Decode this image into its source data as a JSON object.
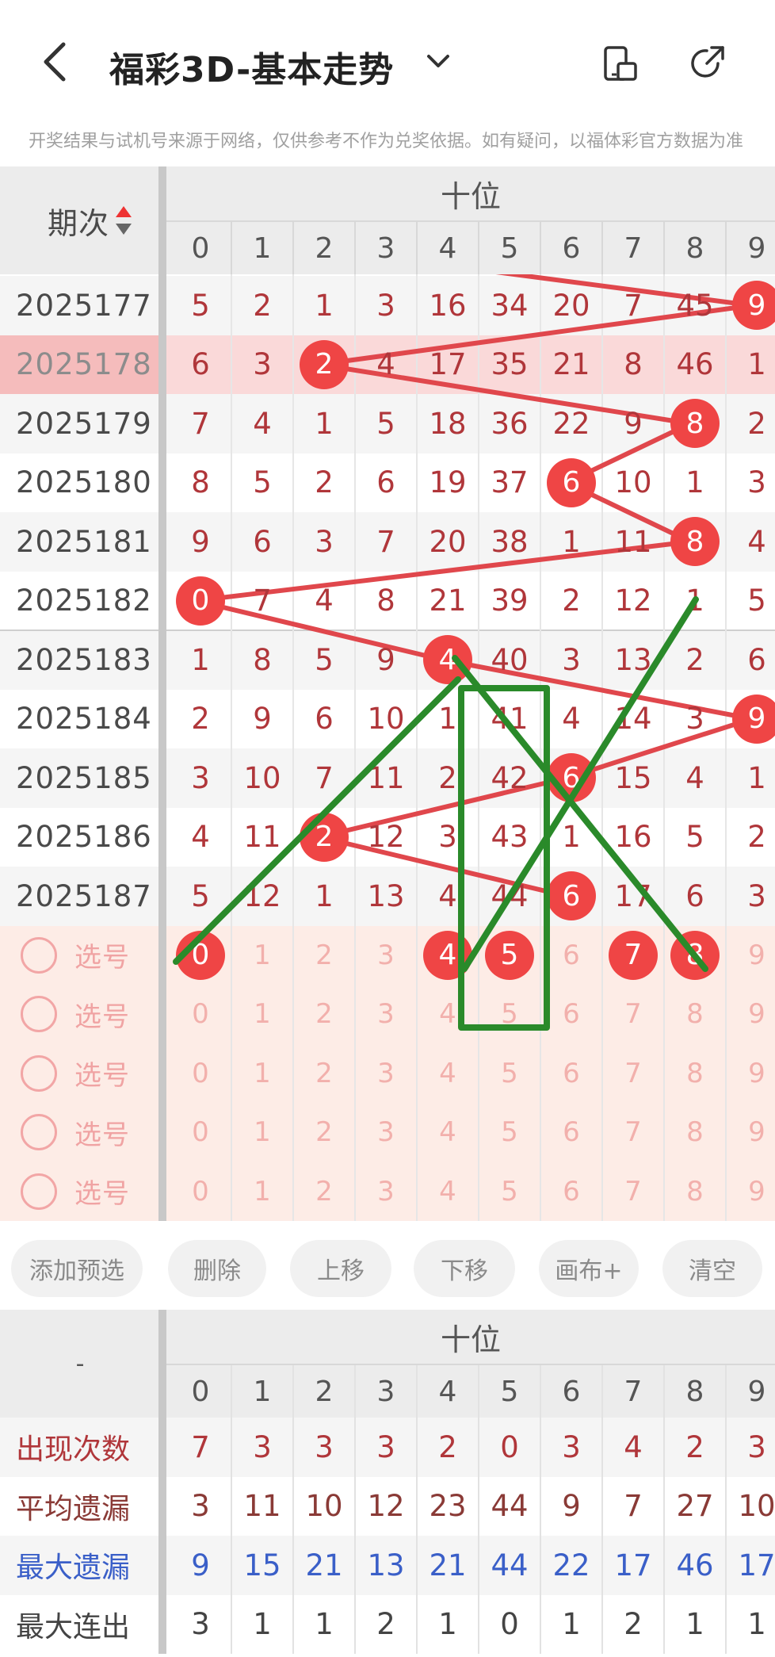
{
  "header": {
    "title": "福彩3D-基本走势",
    "back_icon": "chevron-left-icon",
    "dropdown_icon": "chevron-down-icon",
    "phone_icon": "phone-rotate-icon",
    "share_icon": "share-icon"
  },
  "notice": "开奖结果与试机号来源于网络，仅供参考不作为兑奖依据。如有疑问，以福体彩官方数据为准",
  "colors": {
    "ball_red": "#ef4545",
    "number_red": "#b0363a",
    "line_red": "#e0474c",
    "draw_green": "#2a8a2a",
    "blue": "#3a5fc8",
    "selection_bg": "#fdece6",
    "highlight_row": "#fad9d9"
  },
  "trend": {
    "issue_header": "期次",
    "sort_icon": "sort-arrows-icon",
    "group_header": "十位",
    "digits": [
      "0",
      "1",
      "2",
      "3",
      "4",
      "5",
      "6",
      "7",
      "8",
      "9"
    ],
    "rows": [
      {
        "issue": "2025177",
        "values": [
          "5",
          "2",
          "1",
          "3",
          "16",
          "34",
          "20",
          "7",
          "45",
          "9"
        ],
        "hit": 9
      },
      {
        "issue": "2025178",
        "values": [
          "6",
          "3",
          "2",
          "4",
          "17",
          "35",
          "21",
          "8",
          "46",
          "1"
        ],
        "hit": 2,
        "highlight": true
      },
      {
        "issue": "2025179",
        "values": [
          "7",
          "4",
          "1",
          "5",
          "18",
          "36",
          "22",
          "9",
          "8",
          "2"
        ],
        "hit": 8
      },
      {
        "issue": "2025180",
        "values": [
          "8",
          "5",
          "2",
          "6",
          "19",
          "37",
          "6",
          "10",
          "1",
          "3"
        ],
        "hit": 6
      },
      {
        "issue": "2025181",
        "values": [
          "9",
          "6",
          "3",
          "7",
          "20",
          "38",
          "1",
          "11",
          "8",
          "4"
        ],
        "hit": 8
      },
      {
        "issue": "2025182",
        "values": [
          "0",
          "7",
          "4",
          "8",
          "21",
          "39",
          "2",
          "12",
          "1",
          "5"
        ],
        "hit": 0
      },
      {
        "issue": "2025183",
        "values": [
          "1",
          "8",
          "5",
          "9",
          "4",
          "40",
          "3",
          "13",
          "2",
          "6"
        ],
        "hit": 4
      },
      {
        "issue": "2025184",
        "values": [
          "2",
          "9",
          "6",
          "10",
          "1",
          "41",
          "4",
          "14",
          "3",
          "9"
        ],
        "hit": 9
      },
      {
        "issue": "2025185",
        "values": [
          "3",
          "10",
          "7",
          "11",
          "2",
          "42",
          "6",
          "15",
          "4",
          "1"
        ],
        "hit": 6
      },
      {
        "issue": "2025186",
        "values": [
          "4",
          "11",
          "2",
          "12",
          "3",
          "43",
          "1",
          "16",
          "5",
          "2"
        ],
        "hit": 2
      },
      {
        "issue": "2025187",
        "values": [
          "5",
          "12",
          "1",
          "13",
          "4",
          "44",
          "6",
          "17",
          "6",
          "3"
        ],
        "hit": 6
      }
    ],
    "partial_top_hit": 2,
    "select_label": "选号",
    "selection_rows": [
      {
        "selected": [
          0,
          4,
          5,
          7,
          8
        ]
      },
      {
        "selected": []
      },
      {
        "selected": []
      },
      {
        "selected": []
      },
      {
        "selected": []
      }
    ]
  },
  "actions": [
    "添加预选",
    "删除",
    "上移",
    "下移",
    "画布+",
    "清空"
  ],
  "stats": {
    "corner": "-",
    "group_header": "十位",
    "digits": [
      "0",
      "1",
      "2",
      "3",
      "4",
      "5",
      "6",
      "7",
      "8",
      "9"
    ],
    "rows": [
      {
        "label": "出现次数",
        "values": [
          "7",
          "3",
          "3",
          "3",
          "2",
          "0",
          "3",
          "4",
          "2",
          "3"
        ],
        "color": "#b0363a"
      },
      {
        "label": "平均遗漏",
        "values": [
          "3",
          "11",
          "10",
          "12",
          "23",
          "44",
          "9",
          "7",
          "27",
          "10"
        ],
        "color": "#8a3a36"
      },
      {
        "label": "最大遗漏",
        "values": [
          "9",
          "15",
          "21",
          "13",
          "21",
          "44",
          "22",
          "17",
          "46",
          "17"
        ],
        "color": "#3a5fc8"
      },
      {
        "label": "最大连出",
        "values": [
          "3",
          "1",
          "1",
          "2",
          "1",
          "0",
          "1",
          "2",
          "1",
          "1"
        ],
        "color": "#444444"
      }
    ]
  }
}
